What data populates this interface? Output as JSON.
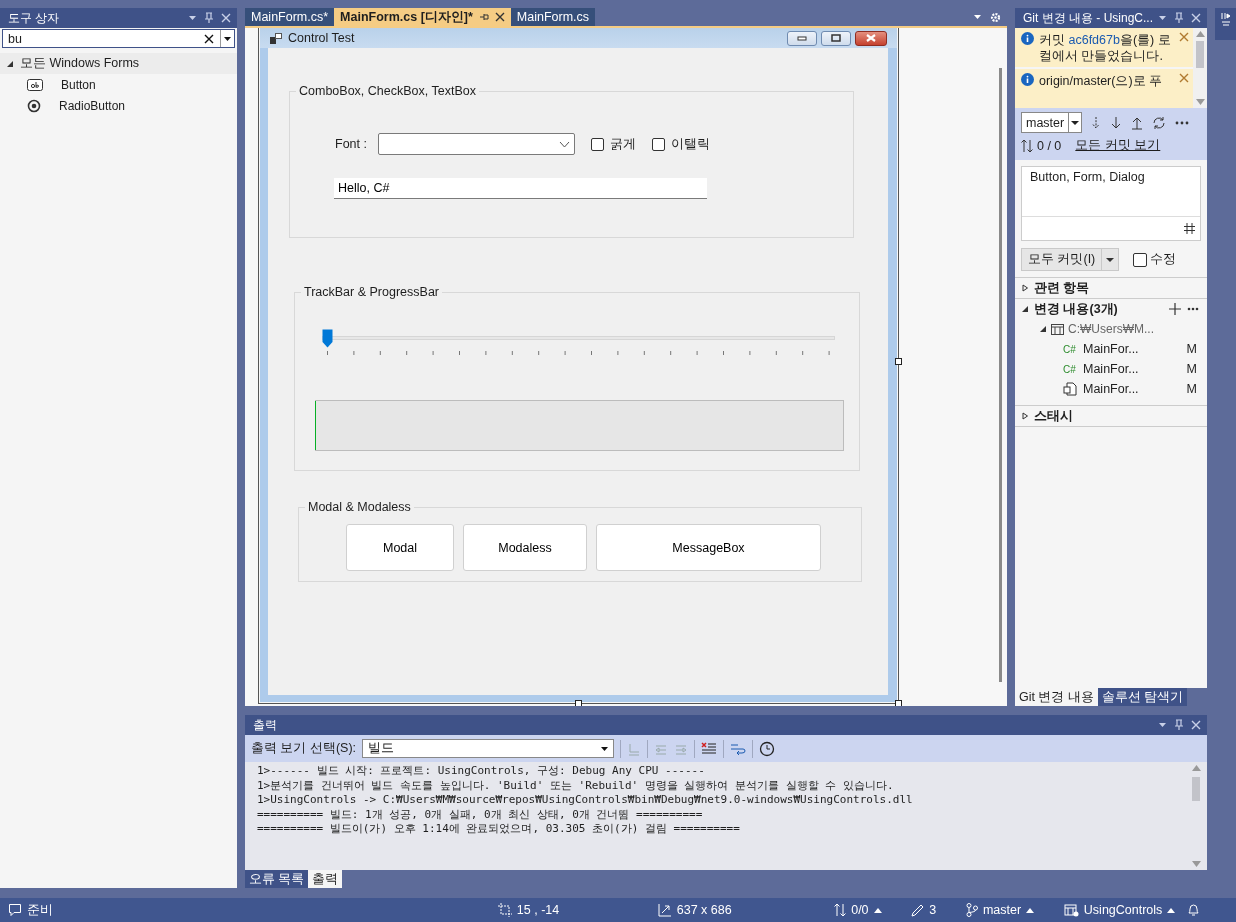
{
  "toolbox": {
    "title": "도구 상자",
    "search": {
      "value": "bu"
    },
    "groups": [
      {
        "label": "모든 Windows Forms",
        "expanded": true,
        "items": [
          {
            "kind": "button",
            "label": "Button"
          },
          {
            "kind": "radio",
            "label": "RadioButton"
          }
        ]
      }
    ]
  },
  "editor_tabs": [
    {
      "label": "MainForm.cs*",
      "selected": false
    },
    {
      "label": "MainForm.cs [디자인]*",
      "selected": true
    },
    {
      "label": "MainForm.cs",
      "selected": false
    }
  ],
  "form": {
    "title": "Control Test",
    "font_group": {
      "title": "ComboBox, CheckBox, TextBox",
      "font_label": "Font :",
      "checkboxes": [
        {
          "label": "굵게",
          "checked": false
        },
        {
          "label": "이탤릭",
          "checked": false
        }
      ],
      "textbox": {
        "value": "Hello, C#"
      }
    },
    "track_group": {
      "title": "TrackBar & ProgressBar",
      "trackbar": {
        "level": 0
      },
      "progressbar": {
        "level": 0
      }
    },
    "dialog_group": {
      "title": "Modal & Modaless",
      "buttons": [
        "Modal",
        "Modaless",
        "MessageBox"
      ]
    }
  },
  "git_panel": {
    "title": "Git 변경 내용 - UsingC...",
    "notifications": [
      {
        "before": "커밋 ",
        "link": "ac6fd67b",
        "after": "을(를) 로컬에서 만들었습니다."
      },
      {
        "before": "origin/master(으)로 푸"
      }
    ],
    "branch": "master",
    "sync": "0 / 0",
    "all_commits_link": "모든 커밋 보기",
    "commit_message": {
      "value": "Button, Form, Dialog"
    },
    "commit_button": "모두 커밋(I)",
    "amend": {
      "label": "수정",
      "checked": false
    },
    "sections": [
      {
        "title": "관련 항목",
        "expanded": false
      },
      {
        "title": "변경 내용(3개)",
        "expanded": true,
        "children": [
          {
            "label": "C:₩Users₩M...",
            "expanded": true,
            "children": [
              {
                "kind": "csharp",
                "icon_text": "C#",
                "label": "MainFor...",
                "status": "M"
              },
              {
                "kind": "csharp",
                "icon_text": "C#",
                "label": "MainFor...",
                "status": "M"
              },
              {
                "kind": "resource",
                "label": "MainFor...",
                "status": "M"
              }
            ]
          }
        ]
      },
      {
        "title": "스태시",
        "expanded": false
      }
    ],
    "tabs": [
      {
        "label": "Git 변경 내용",
        "selected": true
      },
      {
        "label": "솔루션 탐색기",
        "selected": false
      }
    ]
  },
  "output": {
    "title": "출력",
    "source_label": "출력 보기 선택(S):",
    "source": "빌드",
    "lines": [
      "1>------ 빌드 시작: 프로젝트: UsingControls, 구성: Debug Any CPU ------",
      "1>분석기를 건너뛰어 빌드 속도를 높입니다. 'Build' 또는 'Rebuild' 명령을 실행하여 분석기를 실행할 수 있습니다.",
      "1>UsingControls -> C:₩Users₩M₩source₩repos₩UsingControls₩bin₩Debug₩net9.0-windows₩UsingControls.dll",
      "========== 빌드: 1개 성공, 0개 실패, 0개 최신 상태, 0개 건너뜀 ==========",
      "========== 빌드이(가) 오후 1:14에 완료되었으며, 03.305 초이(가) 걸림 =========="
    ],
    "tabs": [
      {
        "label": "오류 목록",
        "selected": false
      },
      {
        "label": "출력",
        "selected": true
      }
    ]
  },
  "status_bar": {
    "message": "준비",
    "position": "15 , -14",
    "size": "637 x 686",
    "sync": "0/0",
    "edits": "3",
    "branch": "master",
    "repo": "UsingControls"
  }
}
